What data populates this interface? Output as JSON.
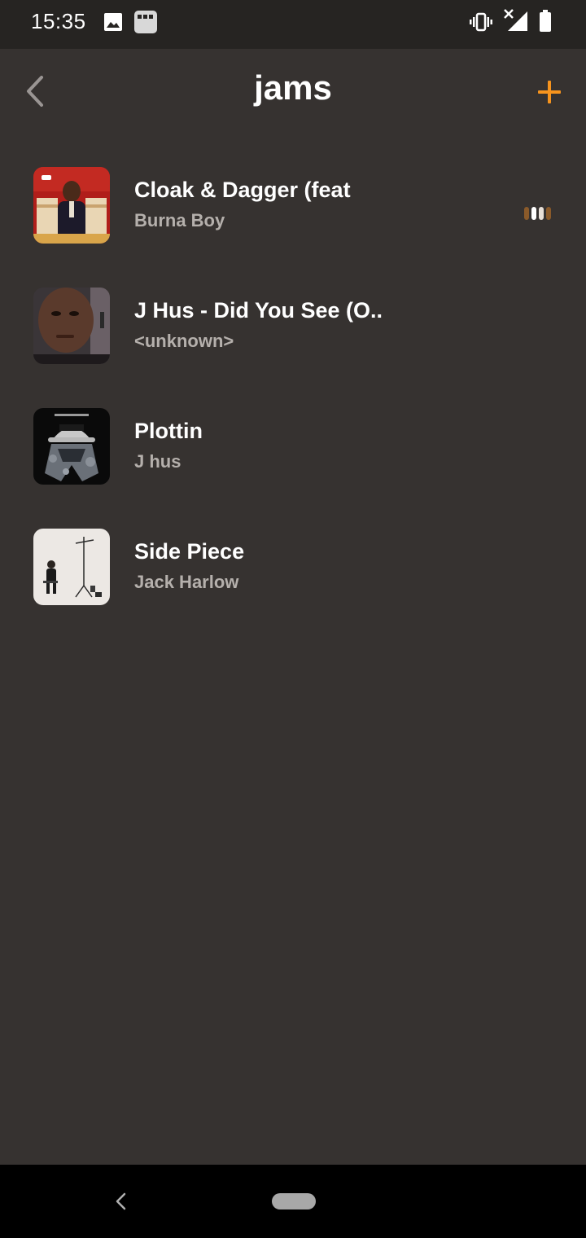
{
  "status_bar": {
    "time": "15:35",
    "icons": [
      "image-icon",
      "app-notification-icon",
      "vibrate-icon",
      "signal-no-data-icon",
      "battery-icon"
    ]
  },
  "header": {
    "back_icon": "chevron-left-icon",
    "title": "jams",
    "add_icon": "plus-icon"
  },
  "tracks": [
    {
      "title": "Cloak & Dagger (feat",
      "artist": "Burna Boy",
      "playing": true
    },
    {
      "title": "J Hus - Did You See (O..",
      "artist": "<unknown>",
      "playing": false
    },
    {
      "title": "Plottin",
      "artist": "J hus",
      "playing": false
    },
    {
      "title": "Side Piece",
      "artist": "Jack Harlow",
      "playing": false
    }
  ],
  "colors": {
    "background": "#363230",
    "status_bar": "#262422",
    "accent": "#f7941d",
    "primary_text": "#ffffff",
    "secondary_text": "#b5b0ac"
  },
  "nav_bar": {
    "back_icon": "nav-back-icon",
    "home_icon": "home-pill-icon"
  }
}
